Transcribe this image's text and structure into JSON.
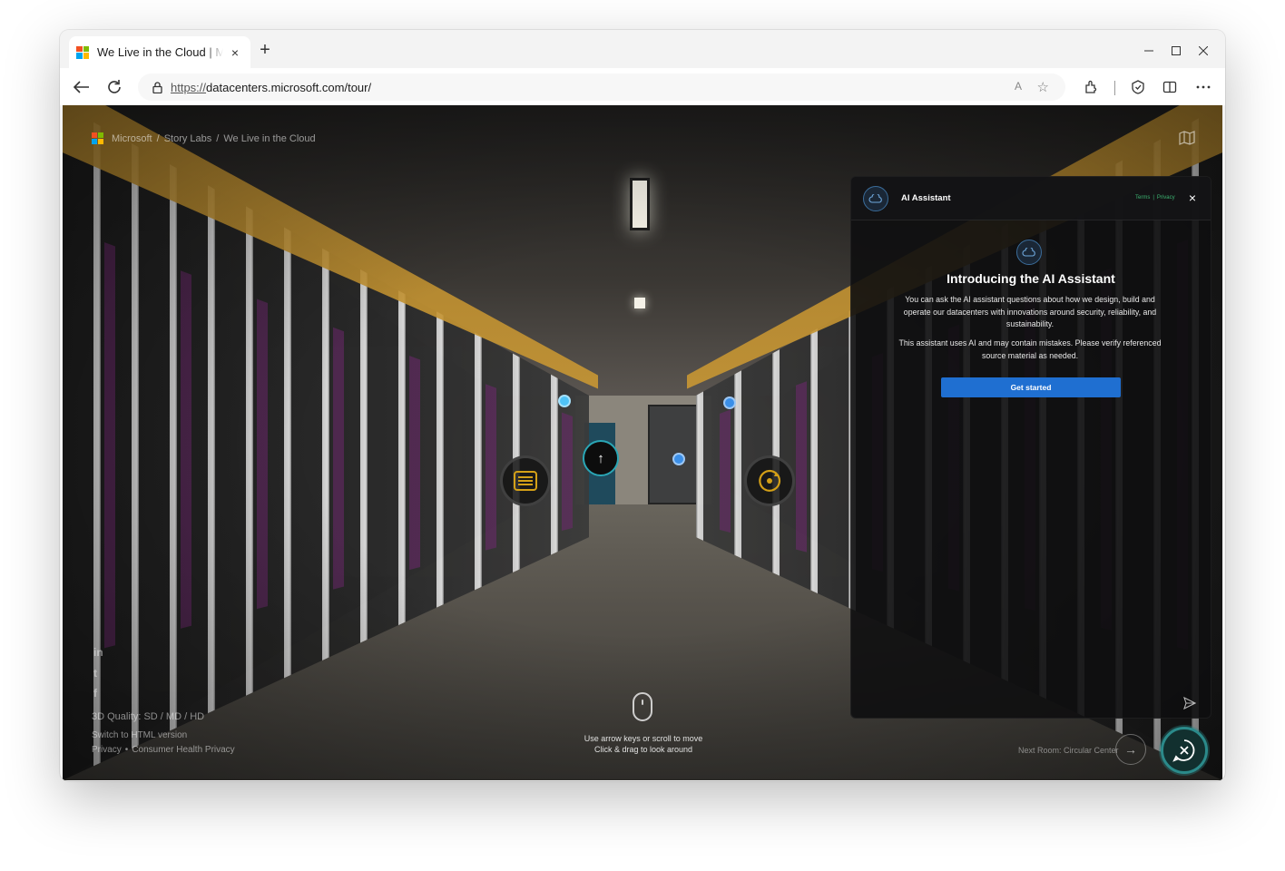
{
  "browser": {
    "tab_title": "We Live in the Cloud | Microsoft",
    "tab_close": "×",
    "new_tab": "+",
    "url_protocol": "https://",
    "url_rest": "datacenters.microsoft.com/tour/",
    "read_aloud": "A",
    "favorite": "☆"
  },
  "page": {
    "breadcrumb": [
      "Microsoft",
      "/",
      "Story Labs",
      "/",
      "We Live in the Cloud"
    ],
    "social": [
      "in",
      "t",
      "f"
    ],
    "quality": "3D Quality: SD / MD / HD",
    "html_link": "Switch to HTML version",
    "privacy": "Privacy",
    "privacy_sep": "•",
    "consumer_health": "Consumer Health Privacy",
    "hint_line1": "Use arrow keys or scroll to move",
    "hint_line2": "Click & drag to look around",
    "next_room": "Next Room: Circular Center",
    "next_arrow": "→",
    "up_arrow": "↑"
  },
  "assistant": {
    "title": "AI Assistant",
    "terms": "Terms",
    "sep": "|",
    "privacy": "Privacy",
    "close": "×",
    "heading": "Introducing the AI Assistant",
    "para1": "You can ask the AI assistant questions about how we design, build and operate our datacenters with innovations around security, reliability, and sustainability.",
    "para2": "This assistant uses AI and may contain mistakes. Please verify referenced source material as needed.",
    "cta": "Get started"
  },
  "colors": {
    "ms_red": "#f25022",
    "ms_green": "#7fba00",
    "ms_blue": "#00a4ef",
    "ms_yellow": "#ffb900",
    "accent_teal": "#2aa6b5",
    "cta_blue": "#1f6fd1",
    "link_green": "#3cb371",
    "hotspot_gold": "#d4a017",
    "dot_blue": "#3b8fe8",
    "dot_cyan": "#4fc3f7"
  },
  "icons": {
    "hotspot_left": "rack-list-icon",
    "hotspot_right": "recycle-icon",
    "chat": "close-chat-icon"
  }
}
